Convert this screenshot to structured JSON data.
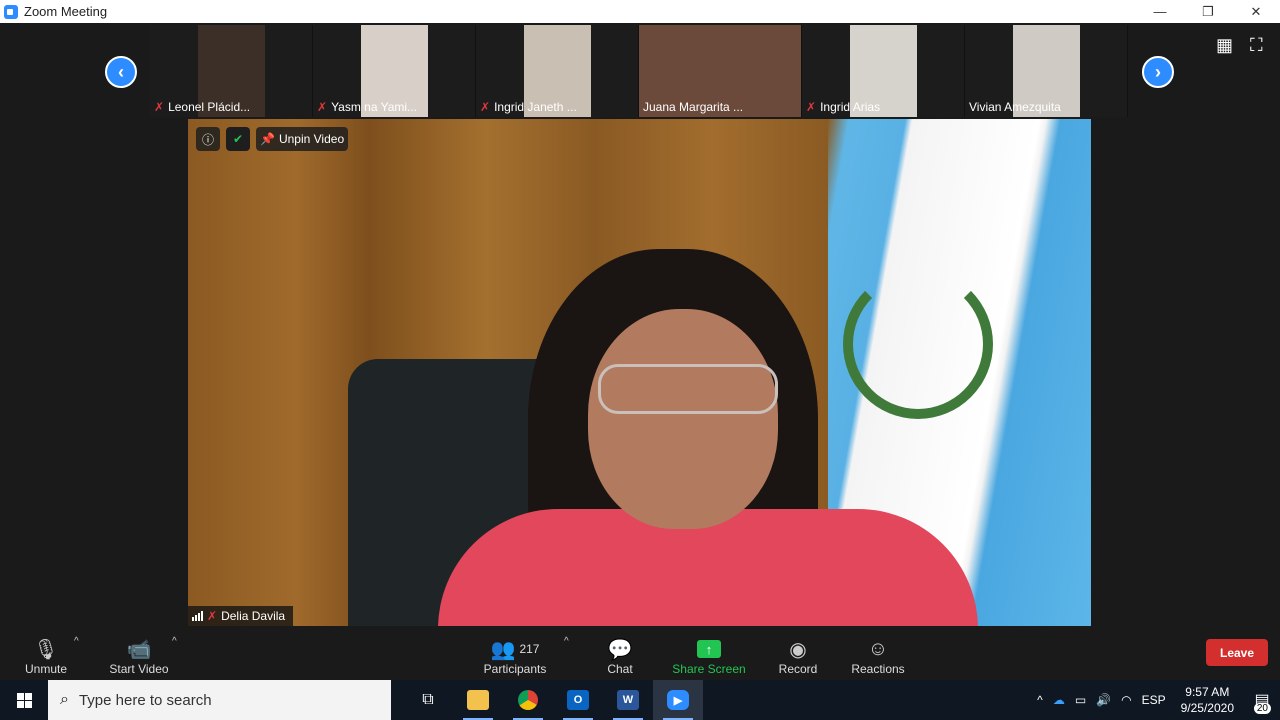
{
  "window": {
    "title": "Zoom Meeting",
    "controls": [
      "—",
      "❐",
      "✕"
    ]
  },
  "gallery": {
    "prev_icon": "chevron-left-icon",
    "next_icon": "chevron-right-icon",
    "participants": [
      {
        "name": "Leonel Plácid...",
        "muted": true,
        "tint": "#3b2f27"
      },
      {
        "name": "Yasm na Yami...",
        "muted": true,
        "tint": "#d8cfc8"
      },
      {
        "name": "Ingrid Janeth ...",
        "muted": true,
        "tint": "#c9bfb2"
      },
      {
        "name": "Juana Margarita ...",
        "muted": false,
        "tint": "#6b4a3c"
      },
      {
        "name": "Ingrid Arias",
        "muted": true,
        "tint": "#d6d3cc"
      },
      {
        "name": "Vivian Amezquita",
        "muted": false,
        "tint": "#cfcac4"
      }
    ]
  },
  "main_video": {
    "pin_label": "Unpin Video",
    "speaker_name": "Delia Davila",
    "speaker_muted": true
  },
  "toolbar": {
    "unmute": "Unmute",
    "start_video": "Start Video",
    "participants_label": "Participants",
    "participants_count": "217",
    "chat": "Chat",
    "share_screen": "Share Screen",
    "record": "Record",
    "reactions": "Reactions",
    "leave": "Leave"
  },
  "taskbar": {
    "search_placeholder": "Type here to search",
    "language": "ESP",
    "time": "9:57 AM",
    "date": "9/25/2020",
    "notifications": "20"
  },
  "colors": {
    "accent": "#2d8cff",
    "leave": "#d32f2f",
    "share": "#23c552",
    "muted": "#e0383e"
  }
}
